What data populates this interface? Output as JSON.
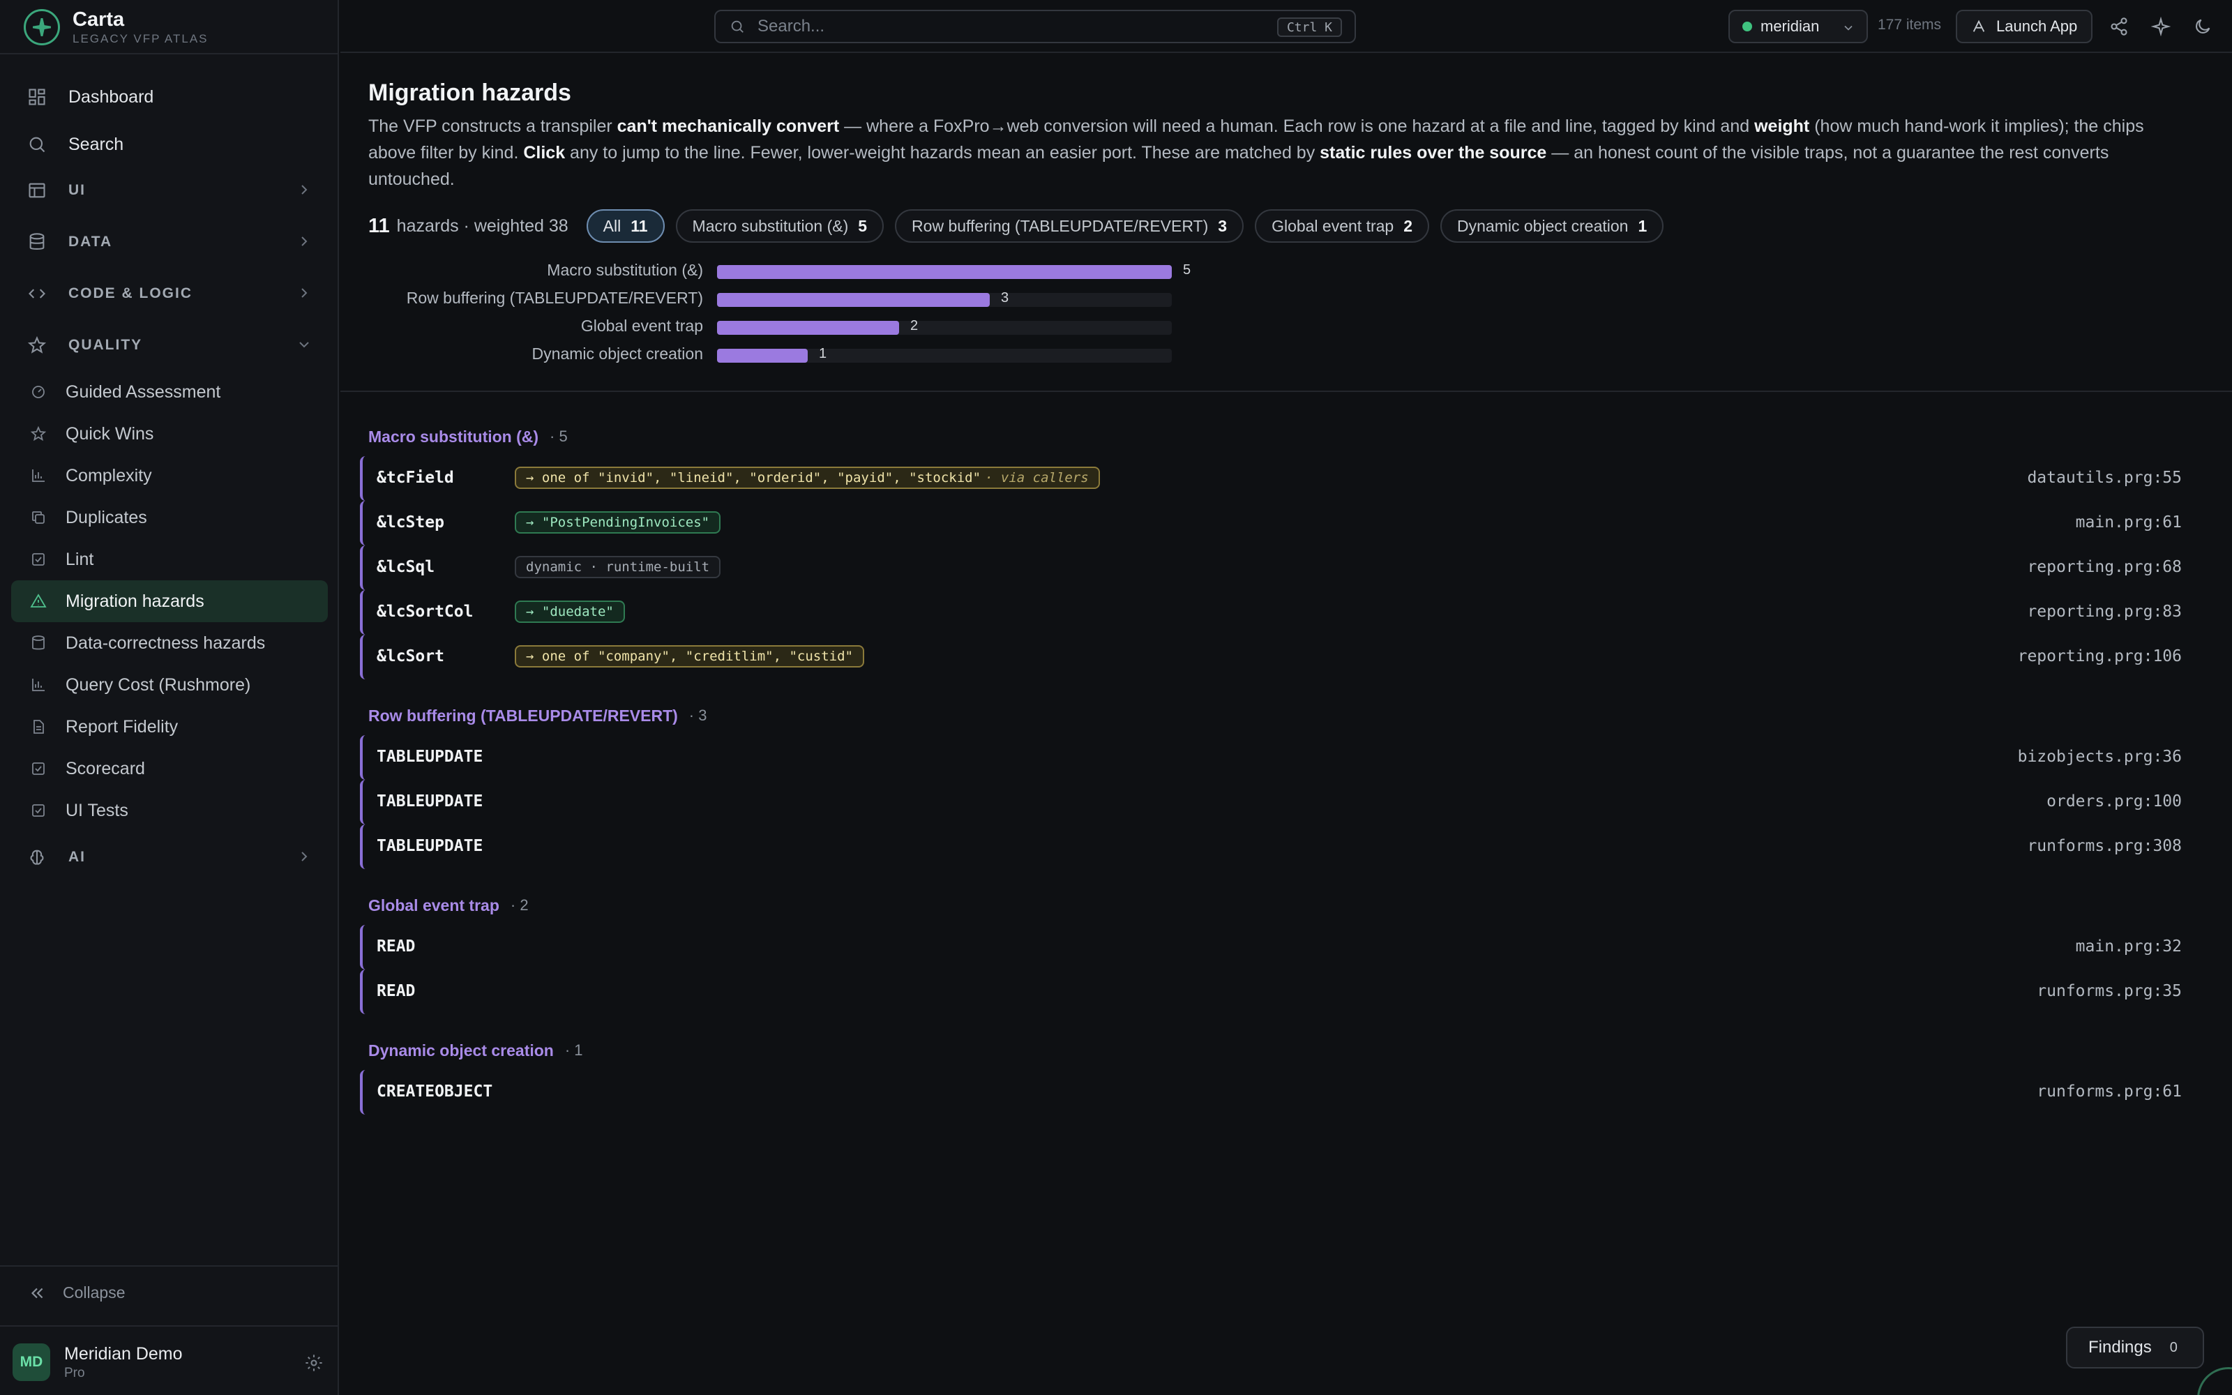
{
  "app": {
    "name": "Carta",
    "subtitle": "LEGACY VFP ATLAS"
  },
  "sidebar": {
    "top_items": [
      {
        "label": "Dashboard",
        "icon": "grid-icon"
      },
      {
        "label": "Search",
        "icon": "search-icon"
      }
    ],
    "sections": [
      {
        "label": "UI",
        "icon": "layout-icon",
        "expanded": false
      },
      {
        "label": "DATA",
        "icon": "database-icon",
        "expanded": false
      },
      {
        "label": "CODE & LOGIC",
        "icon": "code-icon",
        "expanded": false
      },
      {
        "label": "QUALITY",
        "icon": "star-icon",
        "expanded": true
      },
      {
        "label": "AI",
        "icon": "brain-icon",
        "expanded": false
      }
    ],
    "quality_items": [
      {
        "label": "Guided Assessment",
        "icon": "gauge-icon"
      },
      {
        "label": "Quick Wins",
        "icon": "star-icon"
      },
      {
        "label": "Complexity",
        "icon": "bar-chart-icon"
      },
      {
        "label": "Duplicates",
        "icon": "copy-icon"
      },
      {
        "label": "Lint",
        "icon": "check-square-icon"
      },
      {
        "label": "Migration hazards",
        "icon": "warning-triangle-icon",
        "active": true
      },
      {
        "label": "Data-correctness hazards",
        "icon": "database-icon"
      },
      {
        "label": "Query Cost (Rushmore)",
        "icon": "bar-chart-icon"
      },
      {
        "label": "Report Fidelity",
        "icon": "document-icon"
      },
      {
        "label": "Scorecard",
        "icon": "check-square-icon"
      },
      {
        "label": "UI Tests",
        "icon": "check-square-icon"
      }
    ],
    "collapse_label": "Collapse",
    "user": {
      "initials": "MD",
      "name": "Meridian Demo",
      "plan": "Pro"
    }
  },
  "topbar": {
    "search_placeholder": "Search...",
    "search_shortcut": "Ctrl K",
    "project": "meridian",
    "project_status_color": "#3fc27f",
    "item_count": "177 items",
    "launch_label": "Launch App"
  },
  "page": {
    "title": "Migration hazards",
    "desc_parts": [
      "The VFP constructs a transpiler ",
      "can't mechanically convert",
      " — where a FoxPro→web conversion will need a human. Each row is one hazard at a file and line, tagged by kind and ",
      "weight",
      " (how much hand-work it implies); the chips above filter by kind. ",
      "Click",
      " any to jump to the line. Fewer, lower-weight hazards mean an easier port. These are matched by ",
      "static rules over the source",
      " — an honest count of the visible traps, not a guarantee the rest converts untouched."
    ],
    "summary_count": "11",
    "summary_text": "hazards · weighted 38",
    "chips": [
      {
        "label": "All",
        "count": "11",
        "active": true
      },
      {
        "label": "Macro substitution (&)",
        "count": "5"
      },
      {
        "label": "Row buffering (TABLEUPDATE/REVERT)",
        "count": "3"
      },
      {
        "label": "Global event trap",
        "count": "2"
      },
      {
        "label": "Dynamic object creation",
        "count": "1"
      }
    ]
  },
  "chart_data": {
    "type": "bar",
    "orientation": "horizontal",
    "categories": [
      "Macro substitution (&)",
      "Row buffering (TABLEUPDATE/REVERT)",
      "Global event trap",
      "Dynamic object creation"
    ],
    "values": [
      5,
      3,
      2,
      1
    ],
    "xlim": [
      0,
      5
    ],
    "color": "#9b7ae0"
  },
  "groups": [
    {
      "title": "Macro substitution (&)",
      "count": "· 5",
      "rows": [
        {
          "name": "&tcField",
          "tag": "→ one of \"invid\", \"lineid\", \"orderid\", \"payid\", \"stockid\"",
          "tag_note": "· via callers",
          "tag_style": "yellow",
          "loc": "datautils.prg:55"
        },
        {
          "name": "&lcStep",
          "tag": "→ \"PostPendingInvoices\"",
          "tag_style": "green",
          "loc": "main.prg:61"
        },
        {
          "name": "&lcSql",
          "tag": "dynamic · runtime-built",
          "tag_style": "gray",
          "loc": "reporting.prg:68"
        },
        {
          "name": "&lcSortCol",
          "tag": "→ \"duedate\"",
          "tag_style": "green",
          "loc": "reporting.prg:83"
        },
        {
          "name": "&lcSort",
          "tag": "→ one of \"company\", \"creditlim\", \"custid\"",
          "tag_style": "yellow",
          "loc": "reporting.prg:106"
        }
      ]
    },
    {
      "title": "Row buffering (TABLEUPDATE/REVERT)",
      "count": "· 3",
      "rows": [
        {
          "name": "TABLEUPDATE",
          "loc": "bizobjects.prg:36"
        },
        {
          "name": "TABLEUPDATE",
          "loc": "orders.prg:100"
        },
        {
          "name": "TABLEUPDATE",
          "loc": "runforms.prg:308"
        }
      ]
    },
    {
      "title": "Global event trap",
      "count": "· 2",
      "rows": [
        {
          "name": "READ",
          "loc": "main.prg:32"
        },
        {
          "name": "READ",
          "loc": "runforms.prg:35"
        }
      ]
    },
    {
      "title": "Dynamic object creation",
      "count": "· 1",
      "rows": [
        {
          "name": "CREATEOBJECT",
          "loc": "runforms.prg:61"
        }
      ]
    }
  ],
  "findings": {
    "label": "Findings",
    "count": "0"
  },
  "colors": {
    "accent": "#4fc08d",
    "hazard": "#9b7ae0",
    "group_title": "#a98be8"
  }
}
